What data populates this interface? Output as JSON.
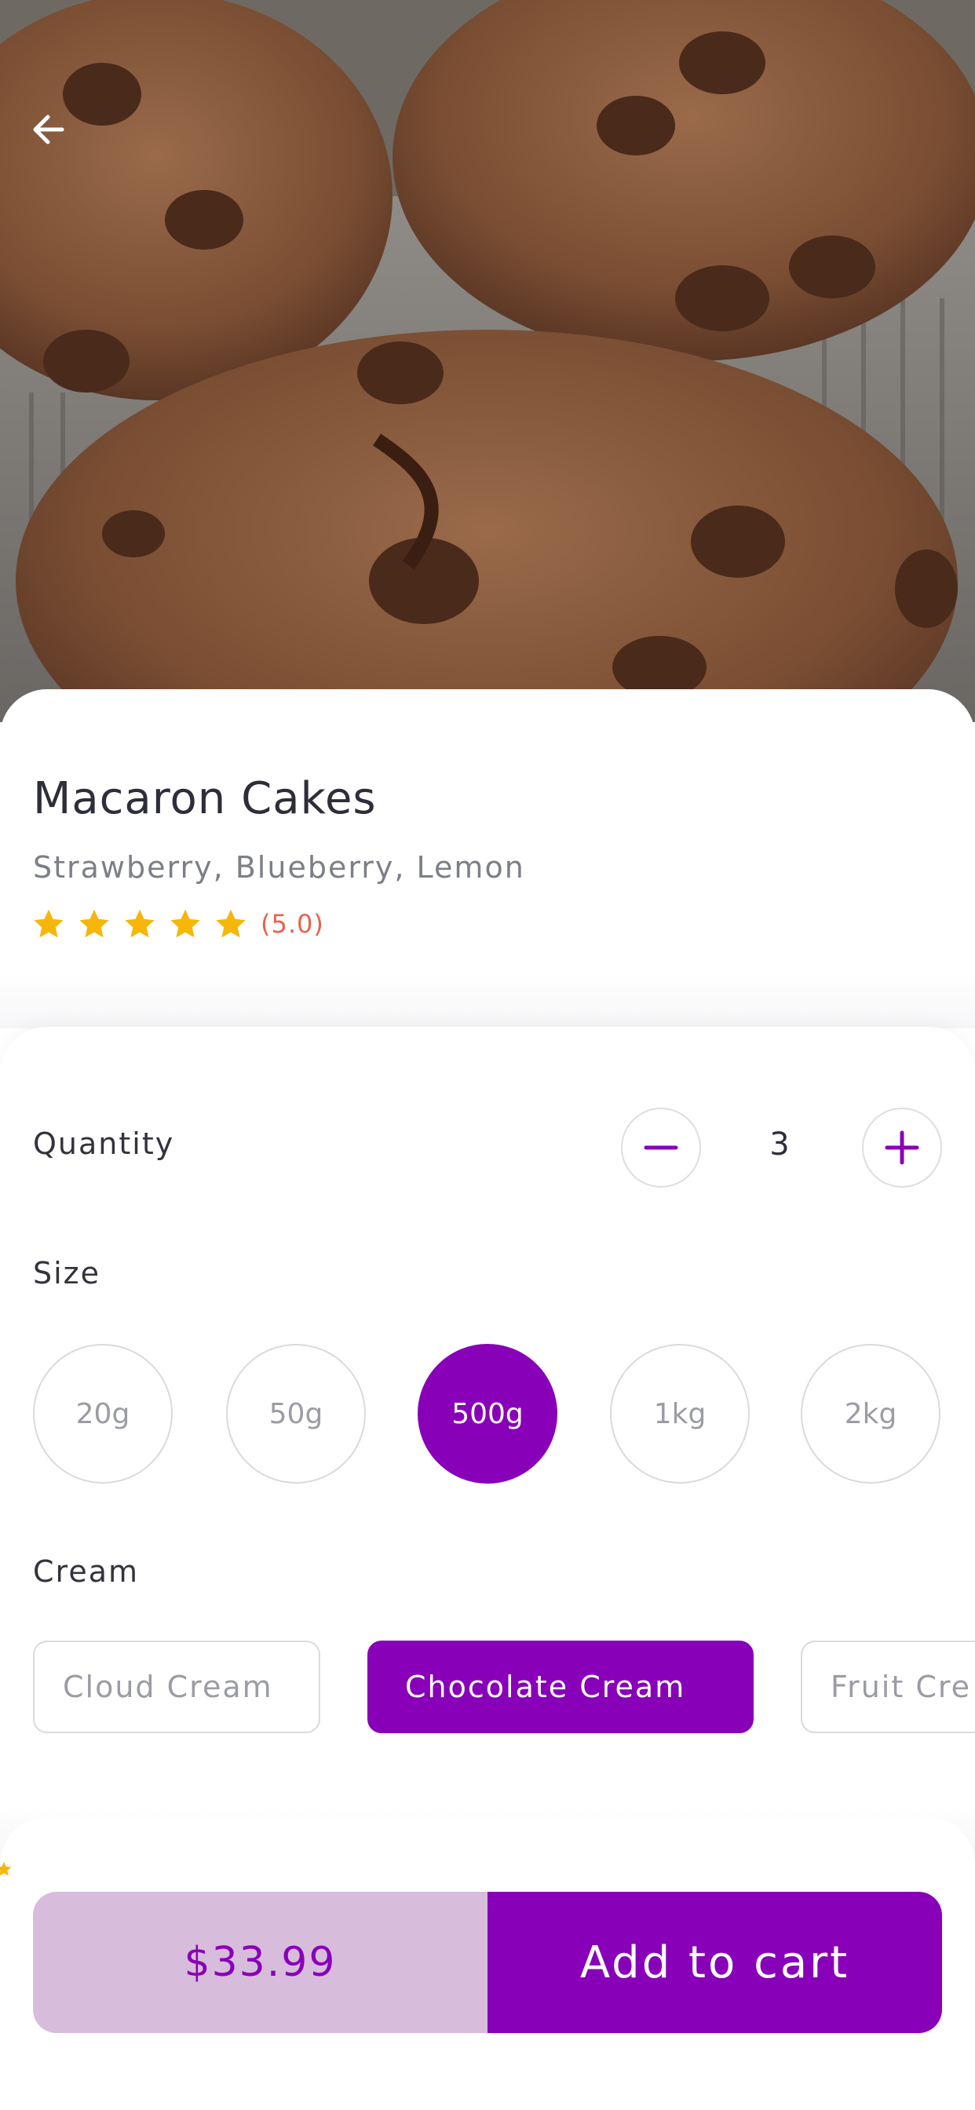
{
  "product": {
    "title": "Macaron Cakes",
    "flavors": "Strawberry, Blueberry, Lemon",
    "rating_text": "(5.0)",
    "rating_stars": 5
  },
  "quantity": {
    "label": "Quantity",
    "value": "3"
  },
  "size": {
    "label": "Size",
    "options": [
      "20g",
      "50g",
      "500g",
      "1kg",
      "2kg"
    ],
    "selected": "500g"
  },
  "cream": {
    "label": "Cream",
    "options": [
      "Cloud Cream",
      "Chocolate Cream",
      "Fruit Cre"
    ],
    "selected": "Chocolate Cream"
  },
  "cart": {
    "price": "$33.99",
    "add_label": "Add to cart"
  },
  "colors": {
    "accent": "#8800b8",
    "accent_light": "#d7bcdc",
    "star": "#f6b60a",
    "rating_text": "#e8624d"
  },
  "icons": {
    "back": "arrow-left-icon",
    "minus": "minus-icon",
    "plus": "plus-icon",
    "star": "star-icon"
  }
}
